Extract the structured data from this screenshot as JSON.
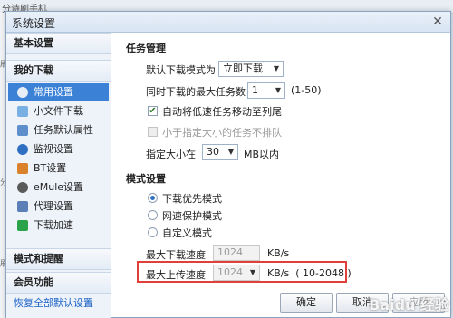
{
  "background": {
    "text": "分诗刷手机",
    "left_chars": [
      "刷",
      "分",
      "刷"
    ]
  },
  "dialog": {
    "title": "系统设置"
  },
  "sidebar": {
    "basic": "基本设置",
    "mydownload": "我的下载",
    "items": [
      {
        "label": "常用设置",
        "icon": "gear-icon",
        "color": "#7aa6d6"
      },
      {
        "label": "小文件下载",
        "icon": "file-icon",
        "color": "#79b0e3"
      },
      {
        "label": "任务默认属性",
        "icon": "task-icon",
        "color": "#5e8fcc"
      },
      {
        "label": "监视设置",
        "icon": "monitor-icon",
        "color": "#2f6fc2"
      },
      {
        "label": "BT设置",
        "icon": "bt-icon",
        "color": "#d9822b"
      },
      {
        "label": "eMule设置",
        "icon": "emule-icon",
        "color": "#5a5a5a"
      },
      {
        "label": "代理设置",
        "icon": "proxy-icon",
        "color": "#5b7fb6"
      },
      {
        "label": "下载加速",
        "icon": "accelerate-icon",
        "color": "#2aa34a"
      }
    ],
    "mode": "模式和提醒",
    "member": "会员功能",
    "restore": "恢复全部默认设置"
  },
  "task": {
    "title": "任务管理",
    "default_mode_label": "默认下载模式为",
    "default_mode_value": "立即下载",
    "max_tasks_label": "同时下载的最大任务数",
    "max_tasks_value": "1",
    "max_tasks_range": "(1-50)",
    "auto_move_label": "自动将低速任务移动至列尾",
    "auto_move_checked": true,
    "small_noqueue_label": "小于指定大小的任务不排队",
    "specify_label": "指定大小在",
    "specify_value": "30",
    "specify_unit": "MB以内"
  },
  "mode": {
    "title": "模式设置",
    "options": [
      "下载优先模式",
      "网速保护模式",
      "自定义模式"
    ],
    "selected": 0,
    "max_down_label": "最大下载速度",
    "max_down_value": "1024",
    "max_down_unit": "KB/s",
    "max_up_label": "最大上传速度",
    "max_up_value": "1024",
    "max_up_unit": "KB/s  ( 10-2048 )"
  },
  "buttons": {
    "ok": "确定",
    "cancel": "取消",
    "apply": "应用"
  },
  "watermark": "Baidu 经验"
}
